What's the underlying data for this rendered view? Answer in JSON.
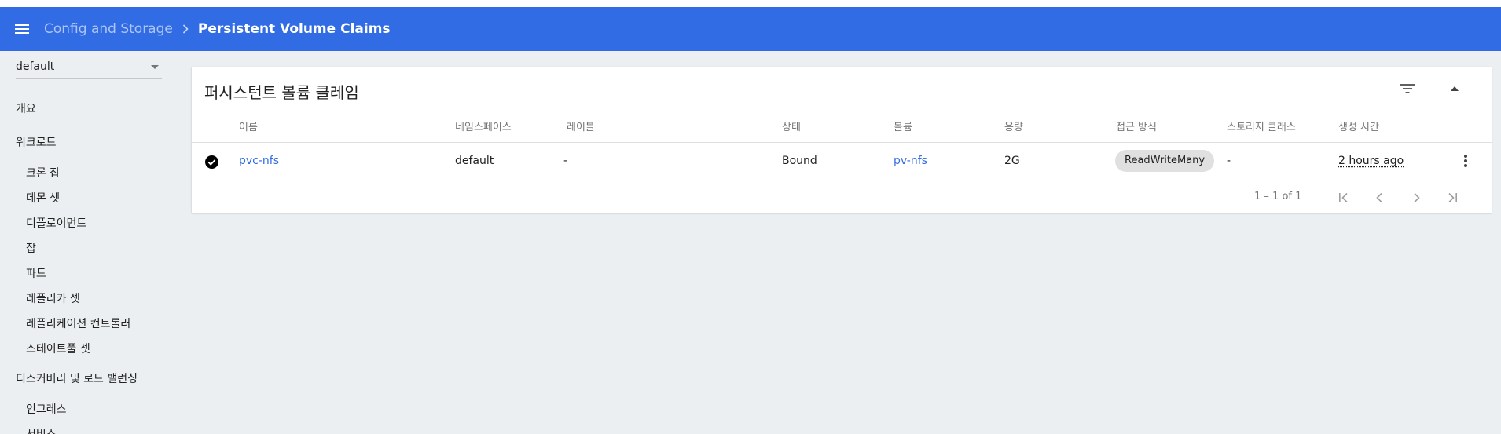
{
  "toolbar": {
    "menu_icon": "menu-icon",
    "breadcrumb_parent": "Config and Storage",
    "breadcrumb_separator_icon": "chevron-right-icon",
    "breadcrumb_current": "Persistent Volume Claims",
    "color": "#326ce5"
  },
  "sidebar": {
    "namespace_value": "default",
    "items": [
      {
        "label": "개요",
        "level": "top"
      },
      {
        "label": "워크로드",
        "level": "top"
      },
      {
        "label": "크론 잡",
        "level": "sub"
      },
      {
        "label": "데몬 셋",
        "level": "sub"
      },
      {
        "label": "디플로이먼트",
        "level": "sub"
      },
      {
        "label": "잡",
        "level": "sub"
      },
      {
        "label": "파드",
        "level": "sub"
      },
      {
        "label": "레플리카 셋",
        "level": "sub"
      },
      {
        "label": "레플리케이션 컨트롤러",
        "level": "sub"
      },
      {
        "label": "스테이트풀 셋",
        "level": "sub"
      },
      {
        "label": "디스커버리 및 로드 밸런싱",
        "level": "top"
      },
      {
        "label": "인그레스",
        "level": "sub"
      },
      {
        "label": "서비스",
        "level": "sub"
      }
    ]
  },
  "card": {
    "title": "퍼시스턴트 볼륨 클레임",
    "filter_icon": "filter-list-icon",
    "collapse_icon": "chevron-up-icon",
    "columns": [
      "이름",
      "네임스페이스",
      "레이블",
      "상태",
      "볼륨",
      "용량",
      "접근 방식",
      "스토리지 클래스",
      "생성 시간"
    ],
    "rows": [
      {
        "status_icon": "check-circle-icon",
        "name": "pvc-nfs",
        "namespace": "default",
        "labels": "-",
        "status": "Bound",
        "volume": "pv-nfs",
        "capacity": "2G",
        "access_modes": "ReadWriteMany",
        "storage_class": "-",
        "created": "2 hours ago",
        "actions_icon": "more-vert-icon"
      }
    ],
    "pagination": {
      "range": "1 – 1 of 1",
      "first_icon": "first-page-icon",
      "prev_icon": "chevron-left-icon",
      "next_icon": "chevron-right-icon",
      "last_icon": "last-page-icon"
    }
  }
}
